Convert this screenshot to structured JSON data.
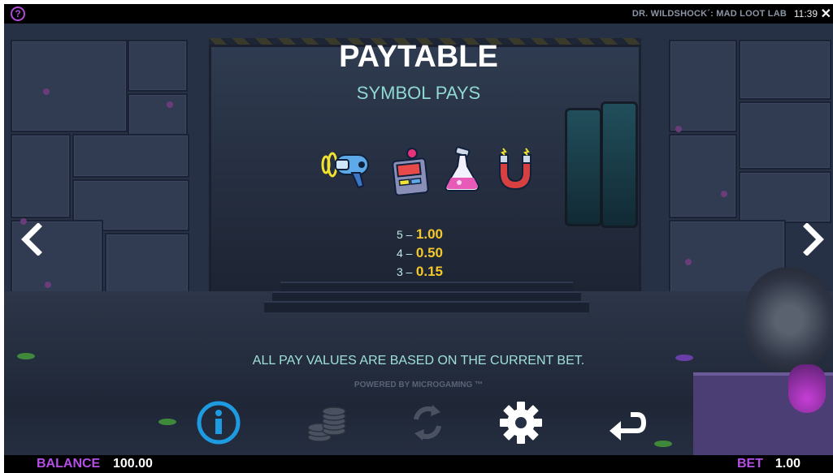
{
  "top_bar": {
    "help_glyph": "?",
    "game_title": "DR. WILDSHOCK´: MAD LOOT LAB",
    "clock": "11:39",
    "close_glyph": "✕"
  },
  "paytable": {
    "title": "PAYTABLE",
    "subtitle": "SYMBOL PAYS",
    "symbols": [
      "ray-gun-icon",
      "remote-control-icon",
      "potion-flask-icon",
      "magnet-icon"
    ],
    "pays": [
      {
        "count": "5 –",
        "value": "1.00"
      },
      {
        "count": "4 –",
        "value": "0.50"
      },
      {
        "count": "3 –",
        "value": "0.15"
      }
    ],
    "note": "ALL PAY VALUES ARE BASED ON THE CURRENT BET.",
    "powered_by": "POWERED BY MICROGAMING ™"
  },
  "navigation": {
    "prev_icon": "chevron-left-icon",
    "next_icon": "chevron-right-icon"
  },
  "controls": [
    {
      "name": "info-button",
      "icon": "info-icon",
      "state": "active"
    },
    {
      "name": "coins-button",
      "icon": "coins-icon",
      "state": "disabled"
    },
    {
      "name": "autoplay-button",
      "icon": "refresh-icon",
      "state": "disabled"
    },
    {
      "name": "settings-button",
      "icon": "gear-icon",
      "state": "enabled"
    },
    {
      "name": "back-button",
      "icon": "return-arrow-icon",
      "state": "enabled"
    }
  ],
  "bottom_bar": {
    "balance_label": "BALANCE",
    "balance_value": "100.00",
    "bet_label": "BET",
    "bet_value": "1.00"
  },
  "colors": {
    "accent_purple": "#b44ee6",
    "pay_value_gold": "#f5c92a",
    "subtitle_teal": "#8fd9d2",
    "info_active_blue": "#1e9be0"
  }
}
